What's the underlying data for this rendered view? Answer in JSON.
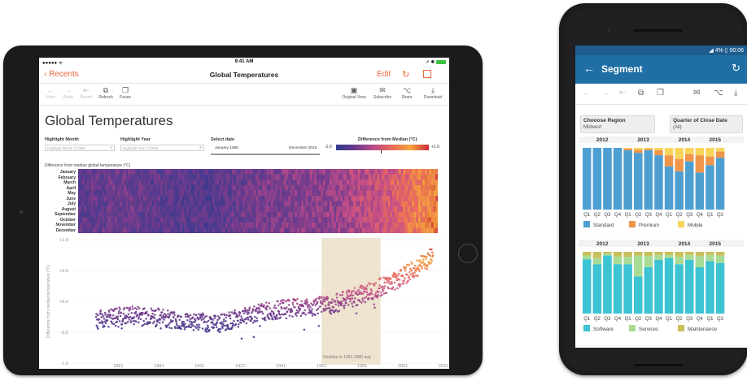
{
  "tablet": {
    "status": {
      "carrier": "●●●●● ᯤ",
      "time": "9:41 AM",
      "right": "➚ ✱"
    },
    "nav": {
      "back_label": "Recents",
      "title": "Global Temperatures",
      "edit_label": "Edit"
    },
    "toolbar": {
      "left": [
        "Undo",
        "Redo",
        "Revert",
        "Refresh",
        "Pause"
      ],
      "right": [
        "Original View",
        "Subscribe",
        "Share",
        "Download"
      ]
    },
    "viz": {
      "title": "Global Temperatures",
      "highlight_month_label": "Highlight Month",
      "highlight_month_placeholder": "Highlight Month of Date",
      "highlight_year_label": "Highlight Year",
      "highlight_year_placeholder": "Highlight Year of Date",
      "select_date_label": "Select date",
      "date_start": "January 1850",
      "date_end": "December 2015",
      "legend_label": "Difference from Median (°C)",
      "legend_min": "-1.0",
      "legend_max": "+1.0",
      "heatmap_title": "Difference from median global temperature (°C)",
      "months": [
        "January",
        "February",
        "March",
        "April",
        "May",
        "June",
        "July",
        "August",
        "September",
        "October",
        "November",
        "December"
      ],
      "band_note": "Relative to 1961-1990 avg"
    }
  },
  "colors": {
    "accent": "#e8683a",
    "android_bar": "#1f6ea4",
    "android_status": "#1d5c8d",
    "band": "#eee3cf"
  },
  "phone": {
    "status_time": "4% ▯ 00:06",
    "title": "Segment",
    "filters": [
      {
        "label": "Chooose Region",
        "value": "Midwest"
      },
      {
        "label": "Quarter of Close Date",
        "value": "(All)"
      }
    ]
  },
  "chart_data": [
    {
      "type": "scatter",
      "ylabel": "Difference from median temperature (°C)",
      "yticks": [
        "+1.0",
        "+0.5",
        "+0.0",
        "-0.5",
        "-1.0"
      ],
      "ylim": [
        -1.0,
        1.0
      ],
      "xticks": [
        "1861",
        "1881",
        "1901",
        "1921",
        "1941",
        "1961",
        "1981",
        "2001",
        "2021"
      ],
      "xlim": [
        1846,
        2021
      ],
      "highlight_range": [
        1961,
        1990
      ],
      "annotation": "Relative to 1961-1990 avg",
      "trend_x": [
        1850,
        1870,
        1890,
        1910,
        1930,
        1950,
        1965,
        1980,
        1995,
        2005,
        2015
      ],
      "trend_y": [
        -0.3,
        -0.22,
        -0.3,
        -0.36,
        -0.18,
        -0.1,
        -0.06,
        0.1,
        0.3,
        0.48,
        0.72
      ]
    },
    {
      "type": "bar",
      "stacked": true,
      "years": [
        "2012",
        "2013",
        "2014",
        "2015"
      ],
      "categories": [
        "Q1",
        "Q2",
        "Q3",
        "Q4",
        "Q1",
        "Q2",
        "Q3",
        "Q4",
        "Q1",
        "Q2",
        "Q3",
        "Q4",
        "Q1",
        "Q2"
      ],
      "ylim": [
        0,
        100
      ],
      "series": [
        {
          "name": "Standard",
          "color": "#4e9fd1",
          "values": [
            100,
            100,
            100,
            100,
            96,
            92,
            96,
            88,
            70,
            62,
            78,
            60,
            72,
            84
          ]
        },
        {
          "name": "Premium",
          "color": "#f0954a",
          "values": [
            0,
            0,
            0,
            0,
            3,
            5,
            2,
            8,
            18,
            20,
            12,
            28,
            14,
            10
          ]
        },
        {
          "name": "Mobile",
          "color": "#f7d55a",
          "values": [
            0,
            0,
            0,
            0,
            1,
            3,
            2,
            4,
            12,
            18,
            10,
            12,
            14,
            6
          ]
        }
      ]
    },
    {
      "type": "bar",
      "stacked": true,
      "years": [
        "2012",
        "2013",
        "2014",
        "2015"
      ],
      "categories": [
        "Q1",
        "Q2",
        "Q3",
        "Q4",
        "Q1",
        "Q2",
        "Q3",
        "Q4",
        "Q1",
        "Q2",
        "Q3",
        "Q4",
        "Q1",
        "Q2"
      ],
      "ylim": [
        0,
        100
      ],
      "series": [
        {
          "name": "Software",
          "color": "#3cc3d4",
          "values": [
            88,
            80,
            94,
            80,
            80,
            60,
            75,
            87,
            90,
            80,
            87,
            75,
            85,
            82
          ]
        },
        {
          "name": "Services",
          "color": "#a8dc96",
          "values": [
            6,
            10,
            3,
            12,
            12,
            34,
            18,
            8,
            5,
            12,
            8,
            18,
            10,
            12
          ]
        },
        {
          "name": "Maintenance",
          "color": "#c8c05a",
          "values": [
            6,
            10,
            3,
            8,
            8,
            6,
            7,
            5,
            5,
            8,
            5,
            7,
            5,
            6
          ]
        }
      ]
    }
  ]
}
